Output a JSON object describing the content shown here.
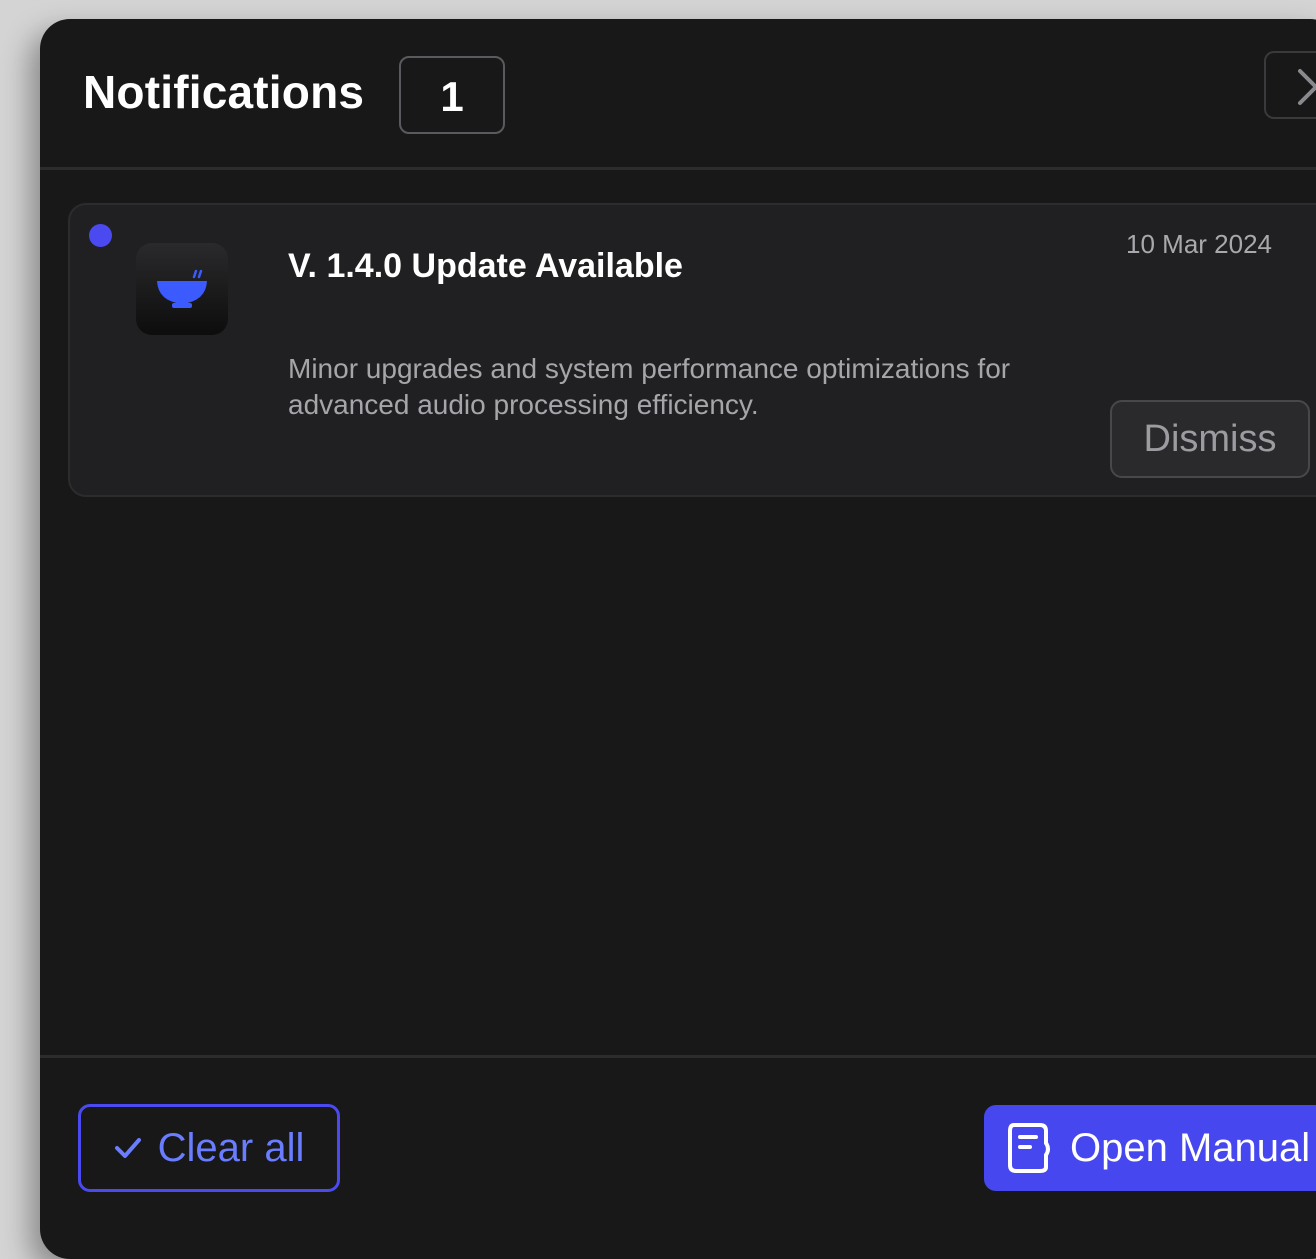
{
  "header": {
    "title": "Notifications",
    "count": "1"
  },
  "notifications": [
    {
      "unread": true,
      "app_icon": "bowl-icon",
      "title": "V. 1.4.0 Update Available",
      "date": "10 Mar 2024",
      "body": "Minor upgrades and system performance optimizations for advanced audio processing efficiency.",
      "dismiss_label": "Dismiss"
    }
  ],
  "footer": {
    "clear_all_label": "Clear all",
    "open_manual_label": "Open Manual"
  },
  "colors": {
    "accent": "#4747f0",
    "panel_bg": "#181819",
    "card_bg": "#202022",
    "unread_dot": "#4a4af0"
  }
}
